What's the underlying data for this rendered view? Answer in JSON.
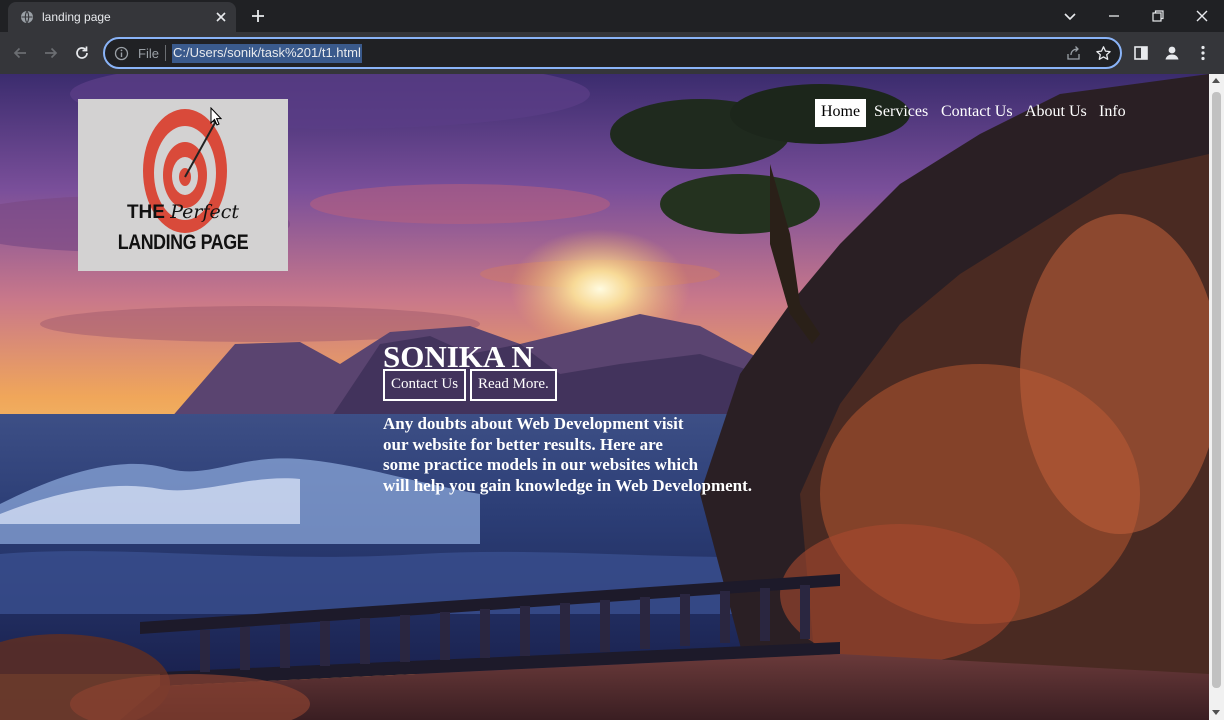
{
  "browser": {
    "tab": {
      "title": "landing page",
      "favicon": "globe-icon",
      "close": "close-icon"
    },
    "new_tab": "plus-icon",
    "window_controls": [
      "chevron-down-icon",
      "minimize-icon",
      "restore-icon",
      "close-icon"
    ],
    "toolbar": {
      "back": "arrow-left-icon",
      "forward": "arrow-right-icon",
      "reload": "reload-icon",
      "omnibox": {
        "scheme_label": "File",
        "url": "C:/Users/sonik/task%201/t1.html",
        "icons": [
          "info-icon",
          "share-icon",
          "star-icon"
        ]
      },
      "right_icons": [
        "side-panel-icon",
        "profile-icon",
        "kebab-menu-icon"
      ]
    }
  },
  "page": {
    "logo": {
      "line1_a": "THE ",
      "line1_b": "Perfect",
      "line2": "LANDING PAGE"
    },
    "nav": {
      "items": [
        {
          "label": "Home",
          "active": true
        },
        {
          "label": "Services",
          "active": false
        },
        {
          "label": "Contact Us",
          "active": false
        },
        {
          "label": "About Us",
          "active": false
        },
        {
          "label": "Info",
          "active": false
        }
      ]
    },
    "hero": {
      "name": "SONIKA N",
      "buttons": [
        {
          "label": "Contact Us"
        },
        {
          "label": "Read More."
        }
      ],
      "text_lines": [
        "Any doubts about Web Development visit",
        "our website for better results. Here are",
        "some practice models in our websites which",
        "will help you gain knowledge in Web Development."
      ]
    }
  },
  "colors": {
    "chrome_dark": "#202124",
    "chrome_toolbar": "#35363a",
    "focus_ring": "#8ab4f8",
    "logo_bg": "#d3d2d2",
    "target_red": "#d94a3a"
  }
}
